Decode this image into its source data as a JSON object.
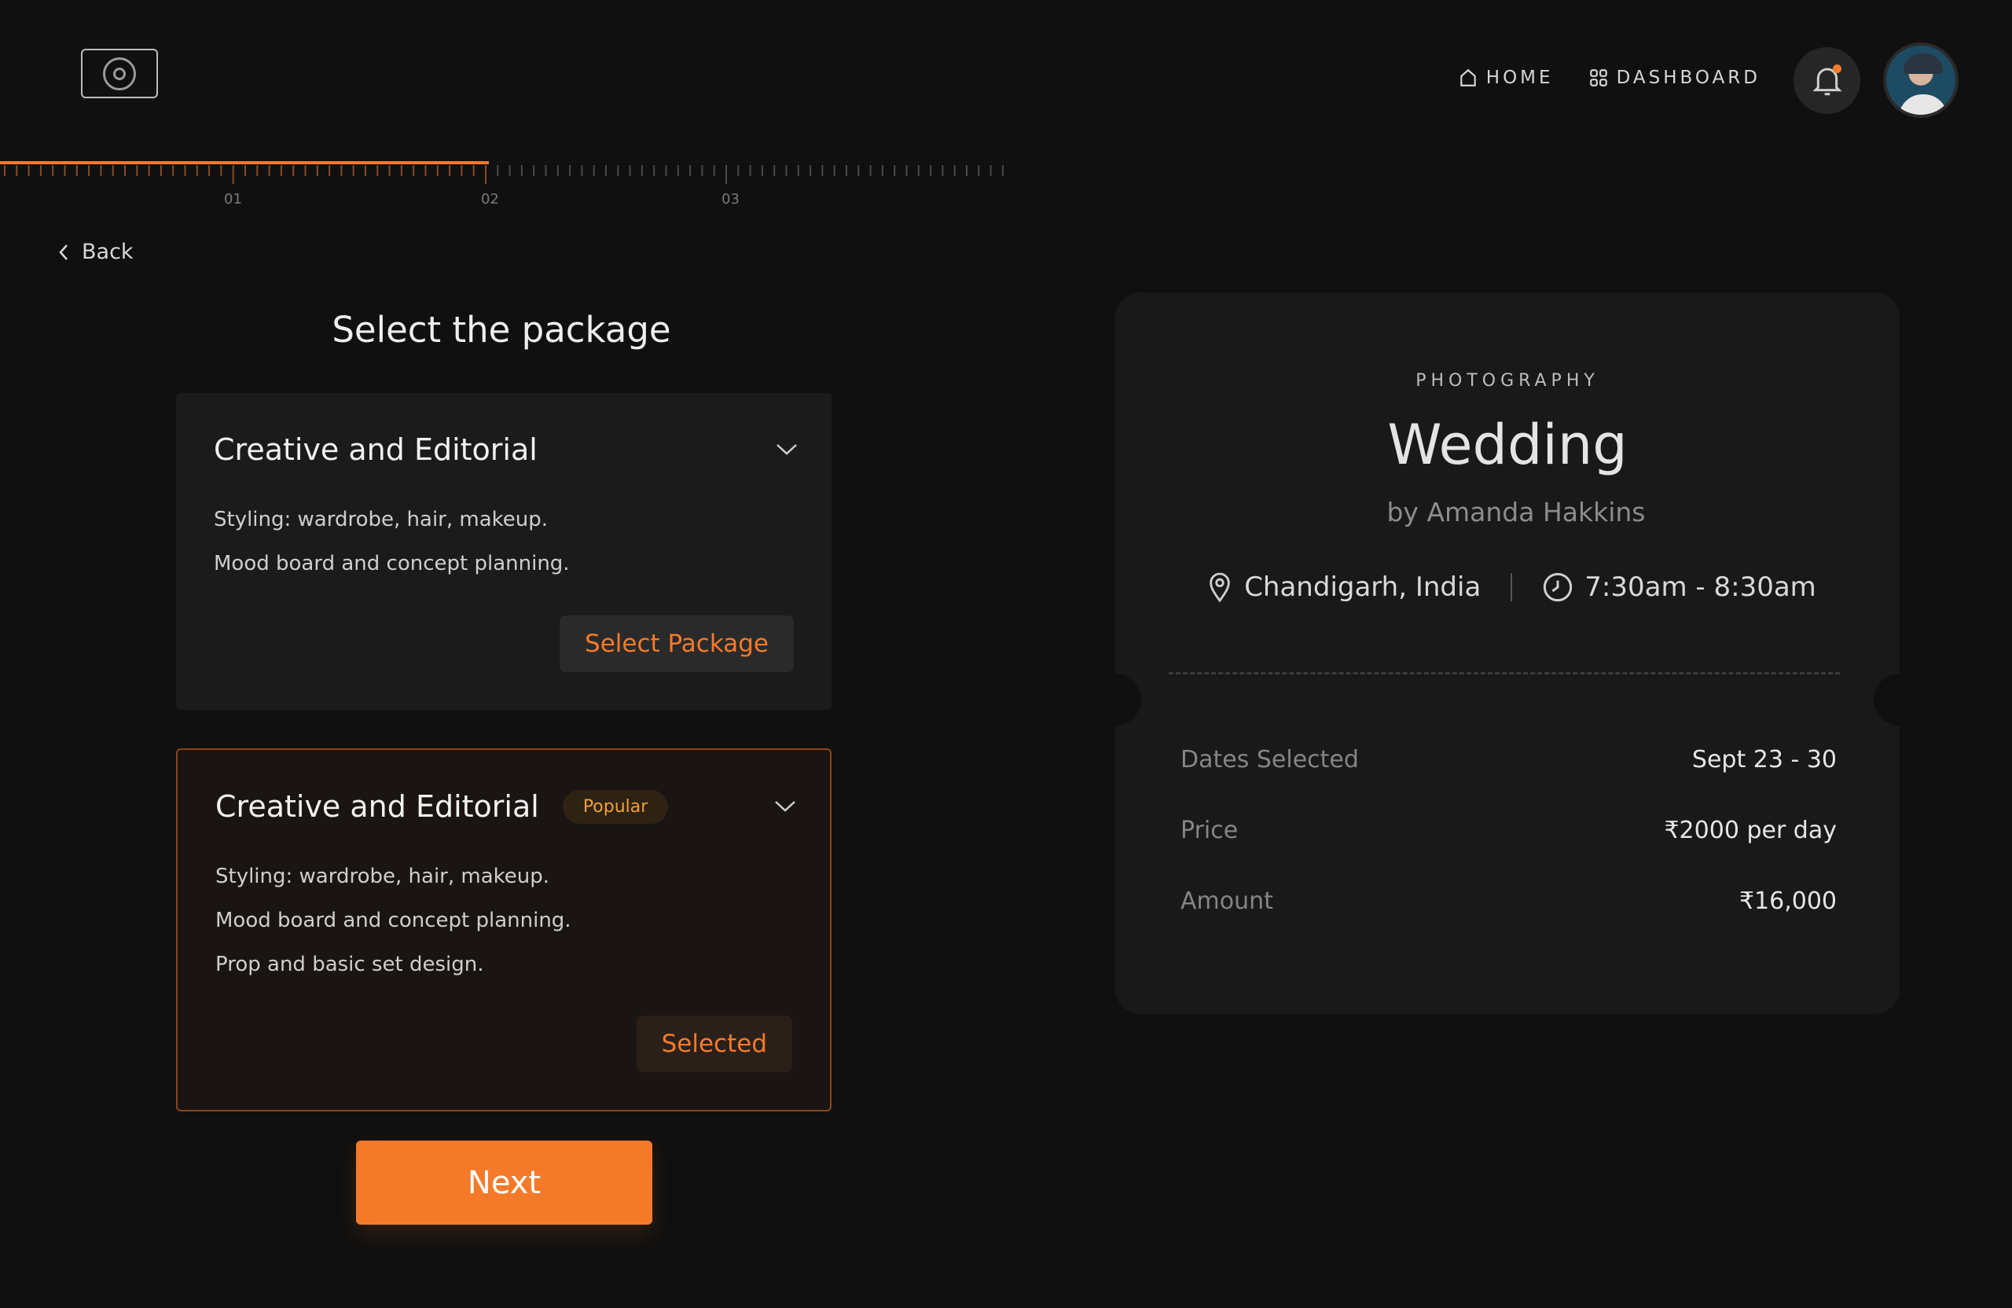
{
  "header": {
    "nav": [
      {
        "label": "HOME",
        "icon": "home-icon"
      },
      {
        "label": "DASHBOARD",
        "icon": "grid-icon"
      }
    ],
    "notification_badge_color": "#f47a2a"
  },
  "progress": {
    "steps": [
      "01",
      "02",
      "03"
    ],
    "current_step": "02",
    "accent_color": "#f47a2a"
  },
  "back_label": "Back",
  "page_title": "Select the package",
  "packages": [
    {
      "title": "Creative and Editorial",
      "badge": "",
      "features": [
        "Styling: wardrobe, hair, makeup.",
        "Mood board and concept planning."
      ],
      "button_label": "Select Package",
      "selected": false
    },
    {
      "title": "Creative and Editorial",
      "badge": "Popular",
      "features": [
        "Styling: wardrobe, hair, makeup.",
        "Mood board and concept planning.",
        "Prop and basic set design."
      ],
      "button_label": "Selected",
      "selected": true
    }
  ],
  "next_label": "Next",
  "summary": {
    "category": "PHOTOGRAPHY",
    "title": "Wedding",
    "by": "by Amanda Hakkins",
    "location": "Chandigarh, India",
    "time": "7:30am - 8:30am",
    "rows": [
      {
        "label": "Dates Selected",
        "value": "Sept 23 - 30"
      },
      {
        "label": "Price",
        "value": "₹2000 per day"
      },
      {
        "label": "Amount",
        "value": "₹16,000"
      }
    ]
  }
}
